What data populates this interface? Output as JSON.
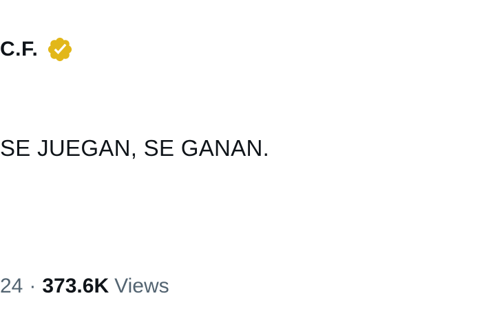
{
  "header": {
    "account_name": "C.F.",
    "verified_badge_color": "#E2B719",
    "verified_icon": "verified-badge-icon"
  },
  "tweet": {
    "text": "SE JUEGAN, SE GANAN."
  },
  "meta": {
    "date_fragment": "24",
    "separator": "·",
    "views_count": "373.6K",
    "views_label": "Views"
  }
}
